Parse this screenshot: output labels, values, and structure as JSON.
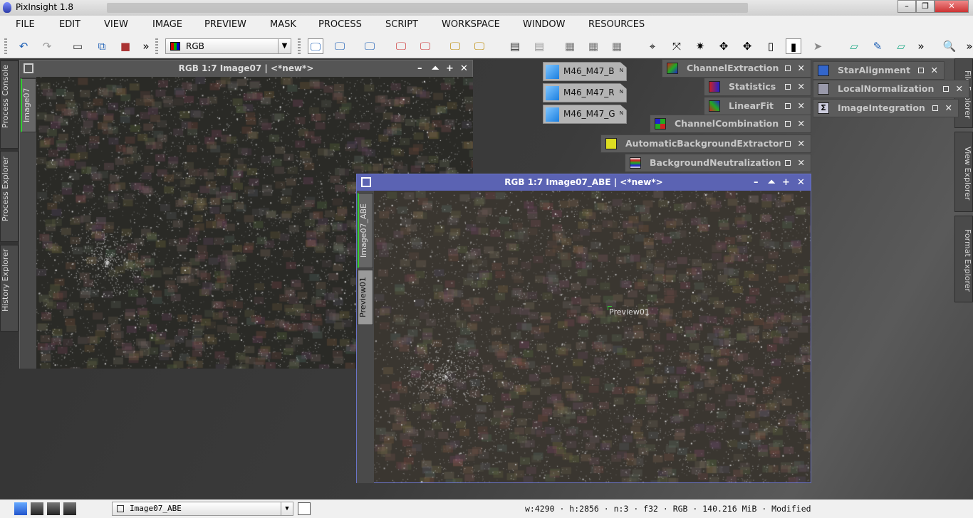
{
  "app": {
    "title": "PixInsight 1.8"
  },
  "menu": [
    "FILE",
    "EDIT",
    "VIEW",
    "IMAGE",
    "PREVIEW",
    "MASK",
    "PROCESS",
    "SCRIPT",
    "WORKSPACE",
    "WINDOW",
    "RESOURCES"
  ],
  "toolbar": {
    "channel_select": "RGB",
    "overflow": "»"
  },
  "left_sidebar": [
    "Process Console",
    "Process Explorer",
    "History Explorer"
  ],
  "right_sidebar": [
    "File Explorer",
    "View Explorer",
    "Format Explorer"
  ],
  "window1": {
    "title": "RGB 1:7 Image07 | <*new*>",
    "tabs": [
      "Image07"
    ]
  },
  "window2": {
    "title": "RGB 1:7 Image07_ABE | <*new*>",
    "tabs": [
      "Image07_ABE",
      "Preview01"
    ],
    "preview_label": "Preview01"
  },
  "image_icons": [
    "M46_M47_B",
    "M46_M47_R",
    "M46_M47_G"
  ],
  "process_icons": [
    "ChannelExtraction",
    "Statistics",
    "LinearFit",
    "ChannelCombination",
    "AutomaticBackgroundExtractor",
    "BackgroundNeutralization",
    "StarAlignment",
    "LocalNormalization",
    "ImageIntegration"
  ],
  "statusbar": {
    "view_select": "Image07_ABE",
    "info": "w:4290 · h:2856 · n:3 · f32 · RGB · 140.216 MiB · Modified"
  }
}
